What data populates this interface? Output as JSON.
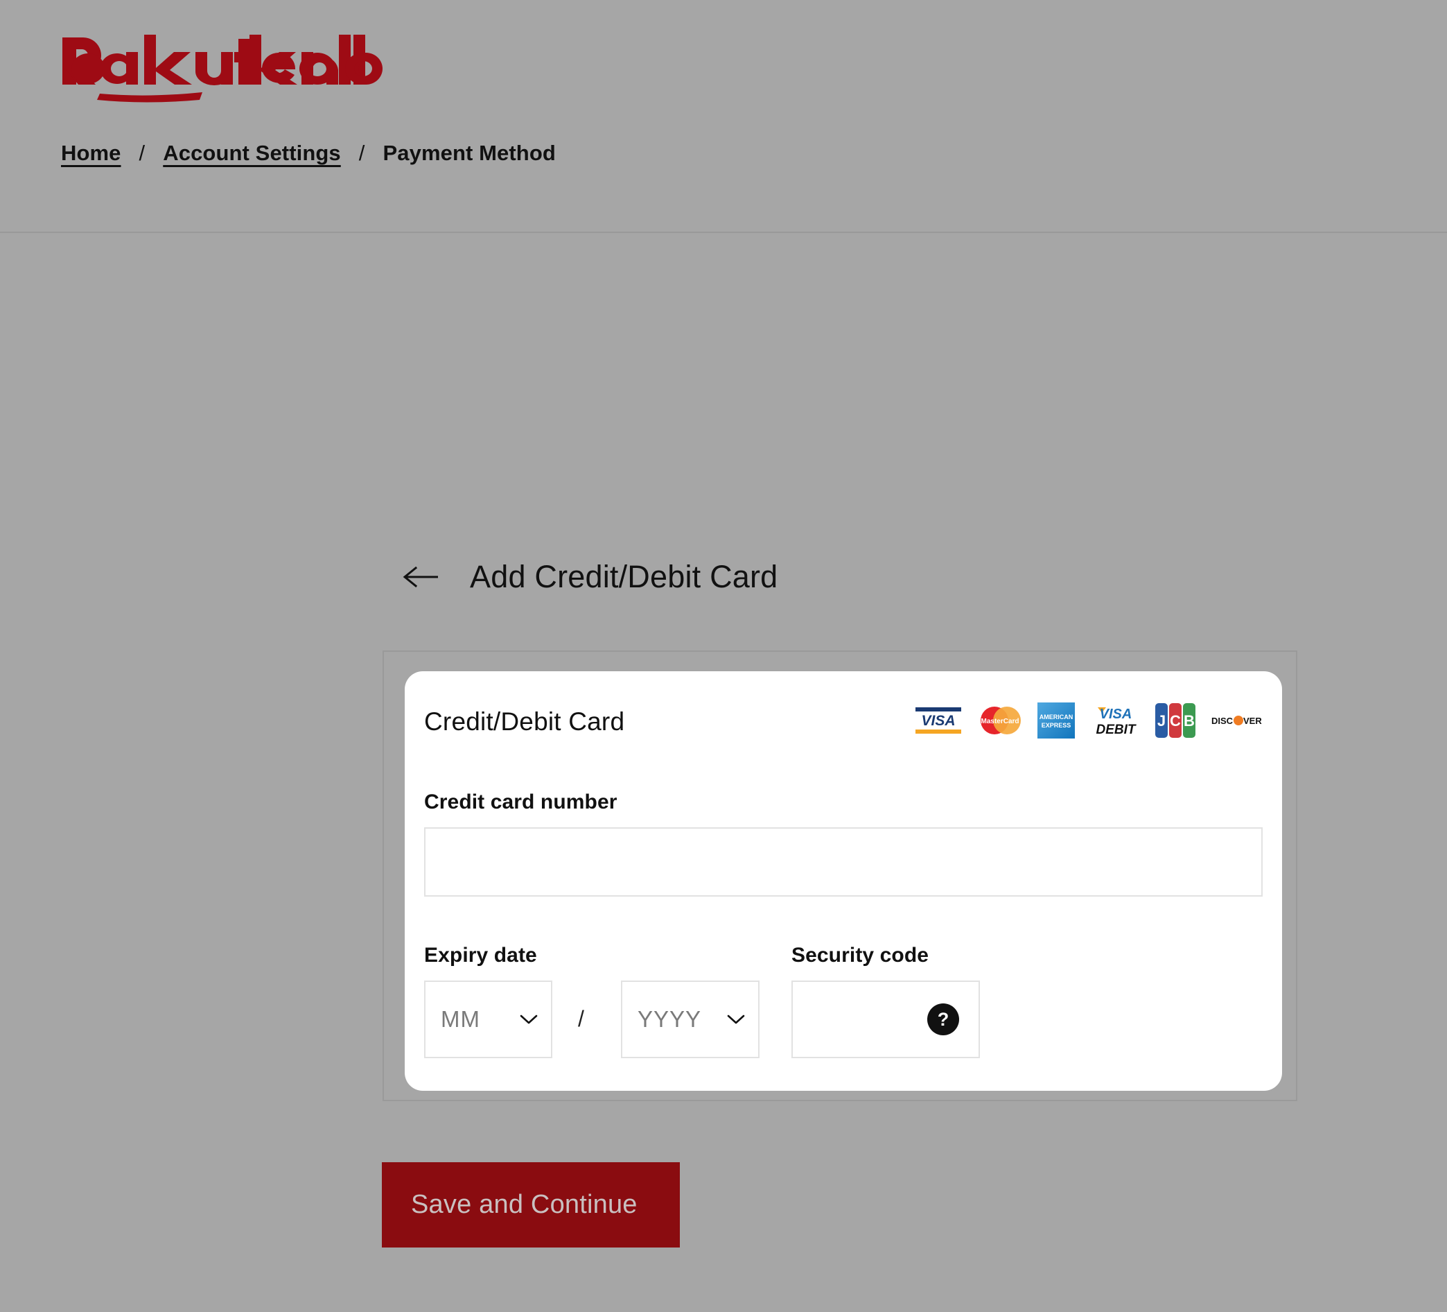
{
  "brand": {
    "name": "Rakuten kobo",
    "word_one": "Rakuten",
    "word_two": "kobo",
    "color": "#9e0b14"
  },
  "breadcrumb": {
    "items": [
      {
        "label": "Home",
        "link": true
      },
      {
        "label": "Account Settings",
        "link": true
      },
      {
        "label": "Payment Method",
        "link": false
      }
    ],
    "separator": "/"
  },
  "page": {
    "back_icon": "arrow-left-icon",
    "title": "Add Credit/Debit Card"
  },
  "card_form": {
    "header_title": "Credit/Debit Card",
    "accepted_brands": [
      {
        "name": "visa",
        "label": "VISA"
      },
      {
        "name": "mastercard",
        "label": "MasterCard"
      },
      {
        "name": "amex",
        "label": "AMERICAN EXPRESS"
      },
      {
        "name": "visa-debit",
        "label": "VISA DEBIT"
      },
      {
        "name": "jcb",
        "label": "JCB"
      },
      {
        "name": "discover",
        "label": "DISCOVER"
      }
    ],
    "card_number": {
      "label": "Credit card number",
      "value": "",
      "placeholder": ""
    },
    "expiry": {
      "label": "Expiry date",
      "month_value": "MM",
      "year_value": "YYYY",
      "separator": "/"
    },
    "security_code": {
      "label": "Security code",
      "value": "",
      "placeholder": "",
      "help_glyph": "?"
    }
  },
  "actions": {
    "save_label": "Save and Continue",
    "save_color": "#8a0c10"
  }
}
